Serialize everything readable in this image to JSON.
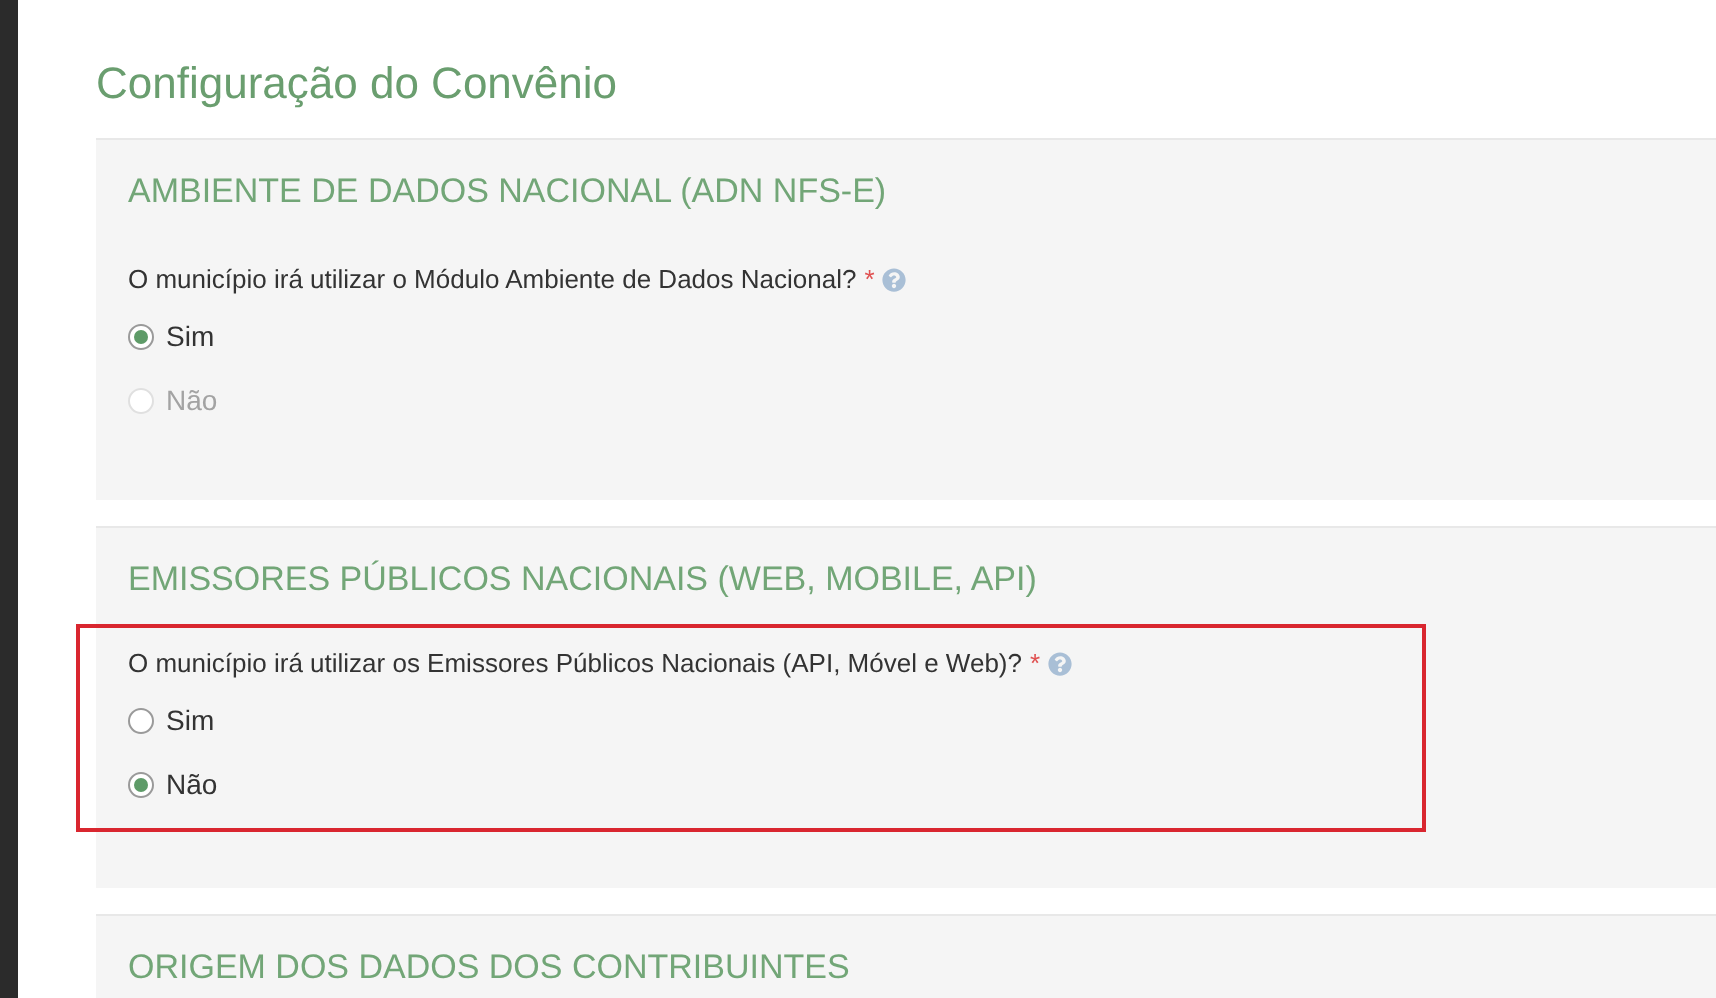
{
  "title": "Configuração do Convênio",
  "sections": [
    {
      "heading": "AMBIENTE DE DADOS NACIONAL (ADN NFS-E)",
      "highlighted": false,
      "question": "O município irá utilizar o Módulo Ambiente de Dados Nacional?",
      "required_mark": "*",
      "options": [
        {
          "label": "Sim",
          "selected": true,
          "disabled": false
        },
        {
          "label": "Não",
          "selected": false,
          "disabled": true
        }
      ]
    },
    {
      "heading": "EMISSORES PÚBLICOS NACIONAIS (WEB, MOBILE, API)",
      "highlighted": true,
      "question": "O município irá utilizar os Emissores Públicos Nacionais (API, Móvel e Web)?",
      "required_mark": "*",
      "options": [
        {
          "label": "Sim",
          "selected": false,
          "disabled": false
        },
        {
          "label": "Não",
          "selected": true,
          "disabled": false
        }
      ]
    },
    {
      "heading": "ORIGEM DOS DADOS DOS CONTRIBUINTES"
    }
  ]
}
